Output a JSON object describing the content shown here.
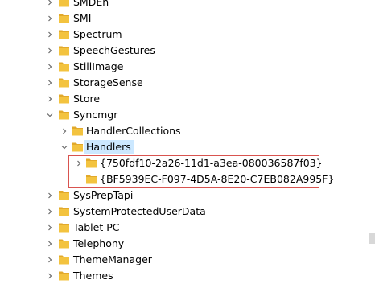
{
  "colors": {
    "folder": "#f3c33f",
    "folder_dark": "#e2a92b",
    "selection": "#cce8ff",
    "highlight_box": "#d9534f"
  },
  "tree": {
    "items": [
      {
        "label": "SMDEn",
        "chevron": "right",
        "depth": 0
      },
      {
        "label": "SMI",
        "chevron": "right",
        "depth": 0
      },
      {
        "label": "Spectrum",
        "chevron": "right",
        "depth": 0
      },
      {
        "label": "SpeechGestures",
        "chevron": "right",
        "depth": 0
      },
      {
        "label": "StillImage",
        "chevron": "right",
        "depth": 0
      },
      {
        "label": "StorageSense",
        "chevron": "right",
        "depth": 0
      },
      {
        "label": "Store",
        "chevron": "right",
        "depth": 0
      },
      {
        "label": "Syncmgr",
        "chevron": "down",
        "depth": 0
      },
      {
        "label": "HandlerCollections",
        "chevron": "right",
        "depth": 1
      },
      {
        "label": "Handlers",
        "chevron": "down",
        "depth": 1,
        "selected": true
      },
      {
        "label": "{750fdf10-2a26-11d1-a3ea-080036587f03}",
        "chevron": "right",
        "depth": 2
      },
      {
        "label": "{BF5939EC-F097-4D5A-8E20-C7EB082A995F}",
        "chevron": "none",
        "depth": 2
      },
      {
        "label": "SysPrepTapi",
        "chevron": "right",
        "depth": 0
      },
      {
        "label": "SystemProtectedUserData",
        "chevron": "right",
        "depth": 0
      },
      {
        "label": "Tablet PC",
        "chevron": "right",
        "depth": 0
      },
      {
        "label": "Telephony",
        "chevron": "right",
        "depth": 0
      },
      {
        "label": "ThemeManager",
        "chevron": "right",
        "depth": 0
      },
      {
        "label": "Themes",
        "chevron": "right",
        "depth": 0
      }
    ]
  }
}
